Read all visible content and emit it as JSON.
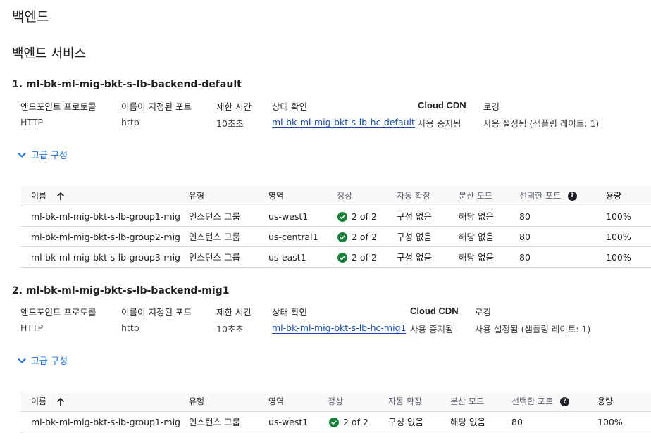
{
  "page": {
    "title": "백엔드",
    "section_title": "백엔드 서비스"
  },
  "backends": [
    {
      "title": "1. ml-bk-ml-mig-bkt-s-lb-backend-default",
      "headers": {
        "protocol": "엔드포인트 프로토콜",
        "named_port": "이름이 지정된 포트",
        "timeout": "제한 시간",
        "health_check": "상태 확인",
        "cdn": "Cloud CDN",
        "logging": "로깅"
      },
      "values": {
        "protocol": "HTTP",
        "named_port": "http",
        "timeout": "10초초",
        "health_check": "ml-bk-ml-mig-bkt-s-lb-hc-default",
        "cdn": "사용 중지됨",
        "logging": "사용 설정됨 (샘플링 레이트: 1)"
      },
      "advanced_label": "고급 구성",
      "table": {
        "columns": [
          "이름",
          "유형",
          "영역",
          "정상",
          "자동 확장",
          "분산 모드",
          "선택한 포트",
          "용량"
        ],
        "rows": [
          [
            "ml-bk-ml-mig-bkt-s-lb-group1-mig",
            "인스턴스 그룹",
            "us-west1",
            "2 of 2",
            "구성 없음",
            "해당 없음",
            "80",
            "100%"
          ],
          [
            "ml-bk-ml-mig-bkt-s-lb-group2-mig",
            "인스턴스 그룹",
            "us-central1",
            "2 of 2",
            "구성 없음",
            "해당 없음",
            "80",
            "100%"
          ],
          [
            "ml-bk-ml-mig-bkt-s-lb-group3-mig",
            "인스턴스 그룹",
            "us-east1",
            "2 of 2",
            "구성 없음",
            "해당 없음",
            "80",
            "100%"
          ]
        ]
      }
    },
    {
      "title": "2. ml-bk-ml-mig-bkt-s-lb-backend-mig1",
      "headers": {
        "protocol": "엔드포인트 프로토콜",
        "named_port": "이름이 지정된 포트",
        "timeout": "제한 시간",
        "health_check": "상태 확인",
        "cdn": "Cloud CDN",
        "logging": "로깅"
      },
      "values": {
        "protocol": "HTTP",
        "named_port": "http",
        "timeout": "10초초",
        "health_check": "ml-bk-ml-mig-bkt-s-lb-hc-mig1",
        "cdn": "사용 중지됨",
        "logging": "사용 설정됨 (샘플링 레이트: 1)"
      },
      "advanced_label": "고급 구성",
      "table": {
        "columns": [
          "이름",
          "유형",
          "영역",
          "정상",
          "자동 확장",
          "분산 모드",
          "선택한 포트",
          "용량"
        ],
        "rows": [
          [
            "ml-bk-ml-mig-bkt-s-lb-group1-mig",
            "인스턴스 그룹",
            "us-west1",
            "2 of 2",
            "구성 없음",
            "해당 없음",
            "80",
            "100%"
          ]
        ]
      }
    }
  ],
  "icons": {
    "sort": "arrow-up-icon",
    "help": "help-icon",
    "expand": "chevron-down-icon",
    "healthy": "check-circle-icon"
  },
  "colors": {
    "link": "#1a73e8",
    "healthy": "#188038",
    "header_bg": "#f8f9fa",
    "border": "#dadce0"
  }
}
